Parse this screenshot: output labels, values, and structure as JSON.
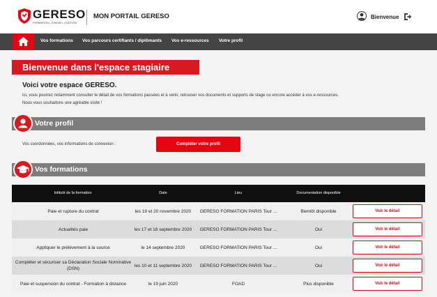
{
  "header": {
    "logo_text": "GERESO",
    "logo_tagline": "FORMATION | CONSEIL | ÉDITION",
    "portal_title": "MON PORTAIL GERESO",
    "welcome": "Bienvenue"
  },
  "nav": {
    "items": [
      {
        "label": "Vos formations"
      },
      {
        "label": "Vos parcours certifiants / diplômants"
      },
      {
        "label": "Vos e-ressources"
      },
      {
        "label": "Votre profil"
      }
    ]
  },
  "banner": {
    "title": "Bienvenue dans l'espace stagiaire"
  },
  "intro": {
    "title": "Voici votre espace GERESO.",
    "line1": "Ici, vous pourrez notamment consulter le détail de vos formations passées et à venir, retrouver vos documents et supports de stage ou encore accéder à vos e-ressources.",
    "line2": "Nous vous souhaitons une agréable visite !"
  },
  "profile": {
    "section_title": "Votre profil",
    "text": "Vos coordonnées, vos informations de connexion :",
    "button": "Compléter votre profil"
  },
  "formations": {
    "section_title": "Vos formations",
    "columns": [
      "Intitulé de la formation",
      "Date",
      "Lieu",
      "Documentation disponible"
    ],
    "button_label": "Voir le détail",
    "rows": [
      {
        "title": "Paie et rupture du contrat",
        "date": "les 19 et 20 novembre 2020",
        "place": "GERESO FORMATION PARIS Tour ...",
        "doc": "Bientôt disponible"
      },
      {
        "title": "Actualités paie",
        "date": "les 17 et 18 septembre 2020",
        "place": "GERESO FORMATION PARIS Tour ...",
        "doc": "Oui"
      },
      {
        "title": "Appliquer le prélèvement à la source",
        "date": "le 14 septembre 2020",
        "place": "GERESO FORMATION PARIS Tour ...",
        "doc": "Oui"
      },
      {
        "title": "Compléter et sécuriser sa Déclaration Sociale Nominative (DSN)",
        "date": "les 10 et 11 septembre 2020",
        "place": "GERESO FORMATION PARIS Tour ...",
        "doc": "Oui"
      },
      {
        "title": "Paie et suspension du contrat - Formation à distance",
        "date": "le 19 juin 2020",
        "place": "FOAD",
        "doc": "Plus disponible"
      }
    ]
  },
  "colors": {
    "brand_red": "#e30613",
    "nav_dark": "#444444",
    "section_grey": "#7d7d7d"
  }
}
